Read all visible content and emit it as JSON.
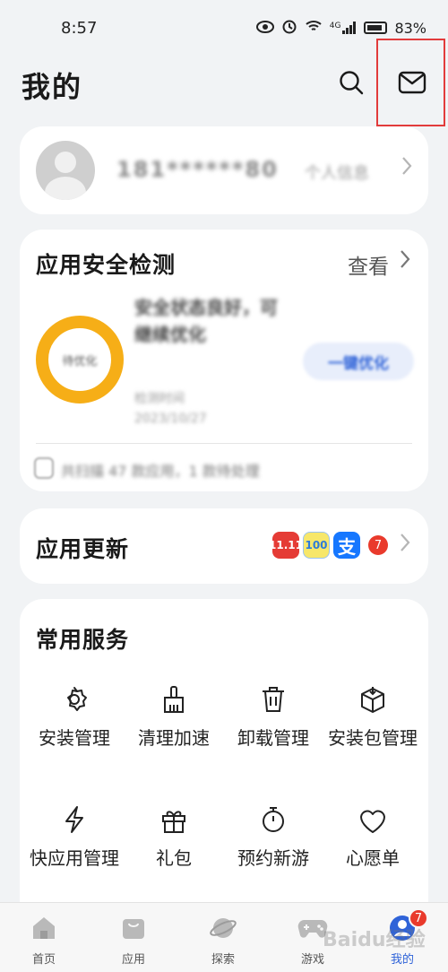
{
  "status_bar": {
    "time": "8:57",
    "network": "4G",
    "battery": "83%"
  },
  "header": {
    "title": "我的"
  },
  "account": {
    "name": "181******80",
    "link": "个人信息"
  },
  "security": {
    "title": "应用安全检测",
    "view_link": "查看",
    "ring_label": "待优化",
    "status": "安全状态良好，可继续优化",
    "time_label": "检测时间",
    "time_value": "2023/10/27",
    "optimize_label": "一键优化",
    "note": "共扫描 47 款应用，1 款待处理"
  },
  "update": {
    "title": "应用更新",
    "apps": [
      "11.11",
      "100",
      "支"
    ],
    "count": "7"
  },
  "services": {
    "title": "常用服务",
    "items": [
      {
        "label": "安装管理"
      },
      {
        "label": "清理加速"
      },
      {
        "label": "卸载管理"
      },
      {
        "label": "安装包管理"
      },
      {
        "label": "快应用管理"
      },
      {
        "label": "礼包"
      },
      {
        "label": "预约新游"
      },
      {
        "label": "心愿单"
      }
    ]
  },
  "bottom_nav": {
    "items": [
      {
        "label": "首页"
      },
      {
        "label": "应用"
      },
      {
        "label": "探索"
      },
      {
        "label": "游戏"
      },
      {
        "label": "我的"
      }
    ],
    "badge": "7"
  },
  "colors": {
    "accent": "#2f63d8",
    "ring": "#f6ae17",
    "badge": "#e93a2c",
    "highlight": "#e23b3b"
  },
  "watermark": "Baidu经验"
}
